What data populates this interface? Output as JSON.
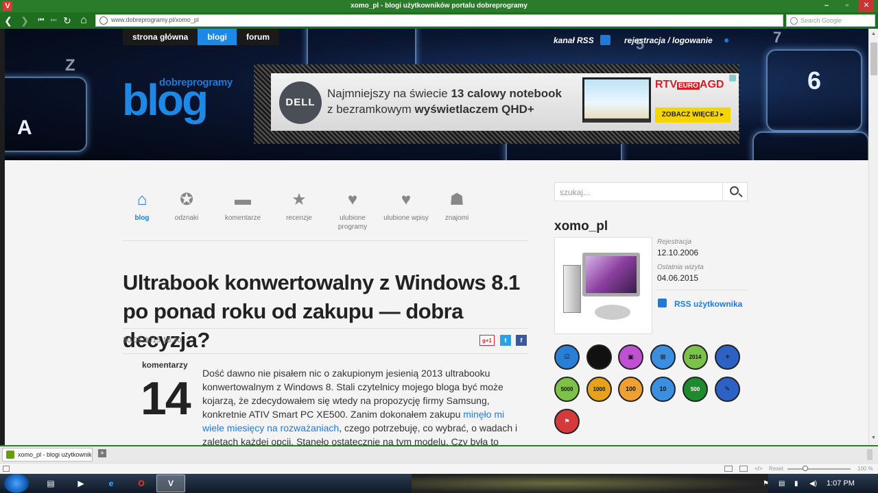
{
  "window": {
    "title": "xomo_pl - blogi użytkowników portalu dobreprogramy",
    "min": "–",
    "max": "▫",
    "close": "✕"
  },
  "nav": {
    "back": "❮",
    "fwd": "❯",
    "first": "⏮",
    "last": "⏭",
    "reload": "↻",
    "home": "⌂"
  },
  "address": {
    "url": "www.dobreprogramy.pl/xomo_pl"
  },
  "search": {
    "placeholder": "Search Google"
  },
  "site": {
    "topnav": [
      "strona główna",
      "blogi",
      "forum"
    ],
    "rss_link": "kanał RSS",
    "login_link": "rejestracja / logowanie",
    "logo_small": "dobreprogramy",
    "logo_big": "blog",
    "hero_keys": [
      "A",
      "6",
      "Z",
      "7",
      "5"
    ]
  },
  "ad": {
    "brand": "DELL",
    "line1_a": "Najmniejszy na świecie ",
    "line1_b": "13 calowy notebook",
    "line2_a": "z bezramkowym ",
    "line2_b": "wyświetlaczem QHD+",
    "retailer_a": "RTV",
    "retailer_b": "EURO",
    "retailer_c": "AGD",
    "cta": "ZOBACZ WIĘCEJ ▸"
  },
  "menu": [
    {
      "label": "blog",
      "icon": "⌂"
    },
    {
      "label": "odznaki",
      "icon": "✪"
    },
    {
      "label": "komentarze",
      "icon": "▬"
    },
    {
      "label": "recenzje",
      "icon": "★"
    },
    {
      "label": "ulubione programy",
      "icon": "♥"
    },
    {
      "label": "ulubione wpisy",
      "icon": "♥"
    },
    {
      "label": "znajomi",
      "icon": "☗"
    }
  ],
  "article": {
    "title": "Ultrabook konwertowalny z Windows 8.1 po ponad roku od zakupu — dobra decyzja?",
    "date": "30.05.2015 18:30",
    "share": [
      "g+1",
      "t",
      "f"
    ],
    "comments_label": "komentarzy",
    "comments_count": "14",
    "body_1": "Dość dawno nie pisałem nic o zakupionym jesienią 2013 ultrabooku konwertowalnym z Windows 8. Stali czytelnicy mojego bloga być może kojarzą, że zdecydowałem się wtedy na propozycję firmy Samsung, konkretnie ATIV Smart PC XE500. Zanim dokonałem zakupu ",
    "body_link": "minęło mi wiele miesięcy na rozważaniach",
    "body_2": ", czego potrzebuję, co wybrać, o wadach i zaletach każdej opcji. Stanęło ostatecznie na tym modelu. Czy była to"
  },
  "sidebar": {
    "search_placeholder": "szukaj...",
    "username": "xomo_pl",
    "reg_label": "Rejestracja",
    "reg_date": "12.10.2006",
    "last_label": "Ostatnia wizyta",
    "last_date": "04.06.2015",
    "rss_user": "RSS użytkownika",
    "badges": [
      {
        "t": "☑",
        "c": "#2a7fd4"
      },
      {
        "t": "☾",
        "c": "#111111"
      },
      {
        "t": "▣",
        "c": "#c04fd4"
      },
      {
        "t": "⊞",
        "c": "#3a8fe0"
      },
      {
        "t": "2014",
        "c": "#7cc24a"
      },
      {
        "t": "☀",
        "c": "#2d62c4"
      },
      {
        "t": "5000",
        "c": "#7cc24a"
      },
      {
        "t": "1000",
        "c": "#e8a21a"
      },
      {
        "t": "100",
        "c": "#f0a030"
      },
      {
        "t": "10",
        "c": "#3a8fe0"
      },
      {
        "t": "500",
        "c": "#1e8a2e"
      },
      {
        "t": "✎",
        "c": "#2d62c4"
      },
      {
        "t": "⚑",
        "c": "#d43a3a"
      }
    ]
  },
  "tab": {
    "label": "xomo_pl - blogi użytkowników",
    "new": "+"
  },
  "status": {
    "reset": "Reset",
    "zoom": "100 %"
  },
  "taskbar": {
    "clock": "1:07 PM",
    "apps": [
      "▤",
      "▶",
      "e",
      "O",
      "V"
    ]
  }
}
